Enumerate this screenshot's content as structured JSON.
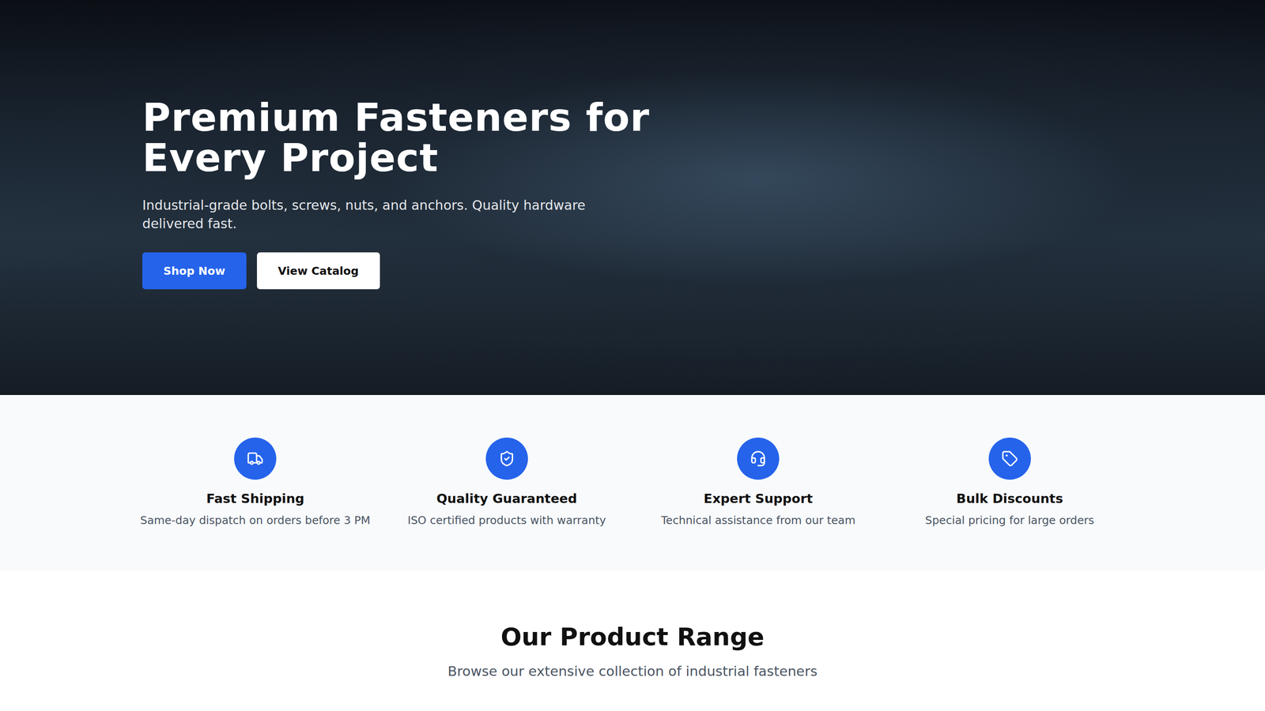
{
  "hero": {
    "title": "Premium Fasteners for Every Project",
    "subtitle": "Industrial-grade bolts, screws, nuts, and anchors. Quality hardware delivered fast.",
    "buttons": [
      {
        "label": "Shop Now",
        "kind": "primary"
      },
      {
        "label": "View Catalog",
        "kind": "secondary"
      }
    ]
  },
  "features": [
    {
      "title": "Fast Shipping",
      "description": "Same-day dispatch on orders before 3 PM"
    },
    {
      "title": "Quality Guaranteed",
      "description": "ISO certified products with warranty"
    },
    {
      "title": "Expert Support",
      "description": "Technical assistance from our team"
    },
    {
      "title": "Bulk Discounts",
      "description": "Special pricing for large orders"
    }
  ],
  "products": {
    "title": "Our Product Range",
    "subtitle": "Browse our extensive collection of industrial fasteners"
  }
}
